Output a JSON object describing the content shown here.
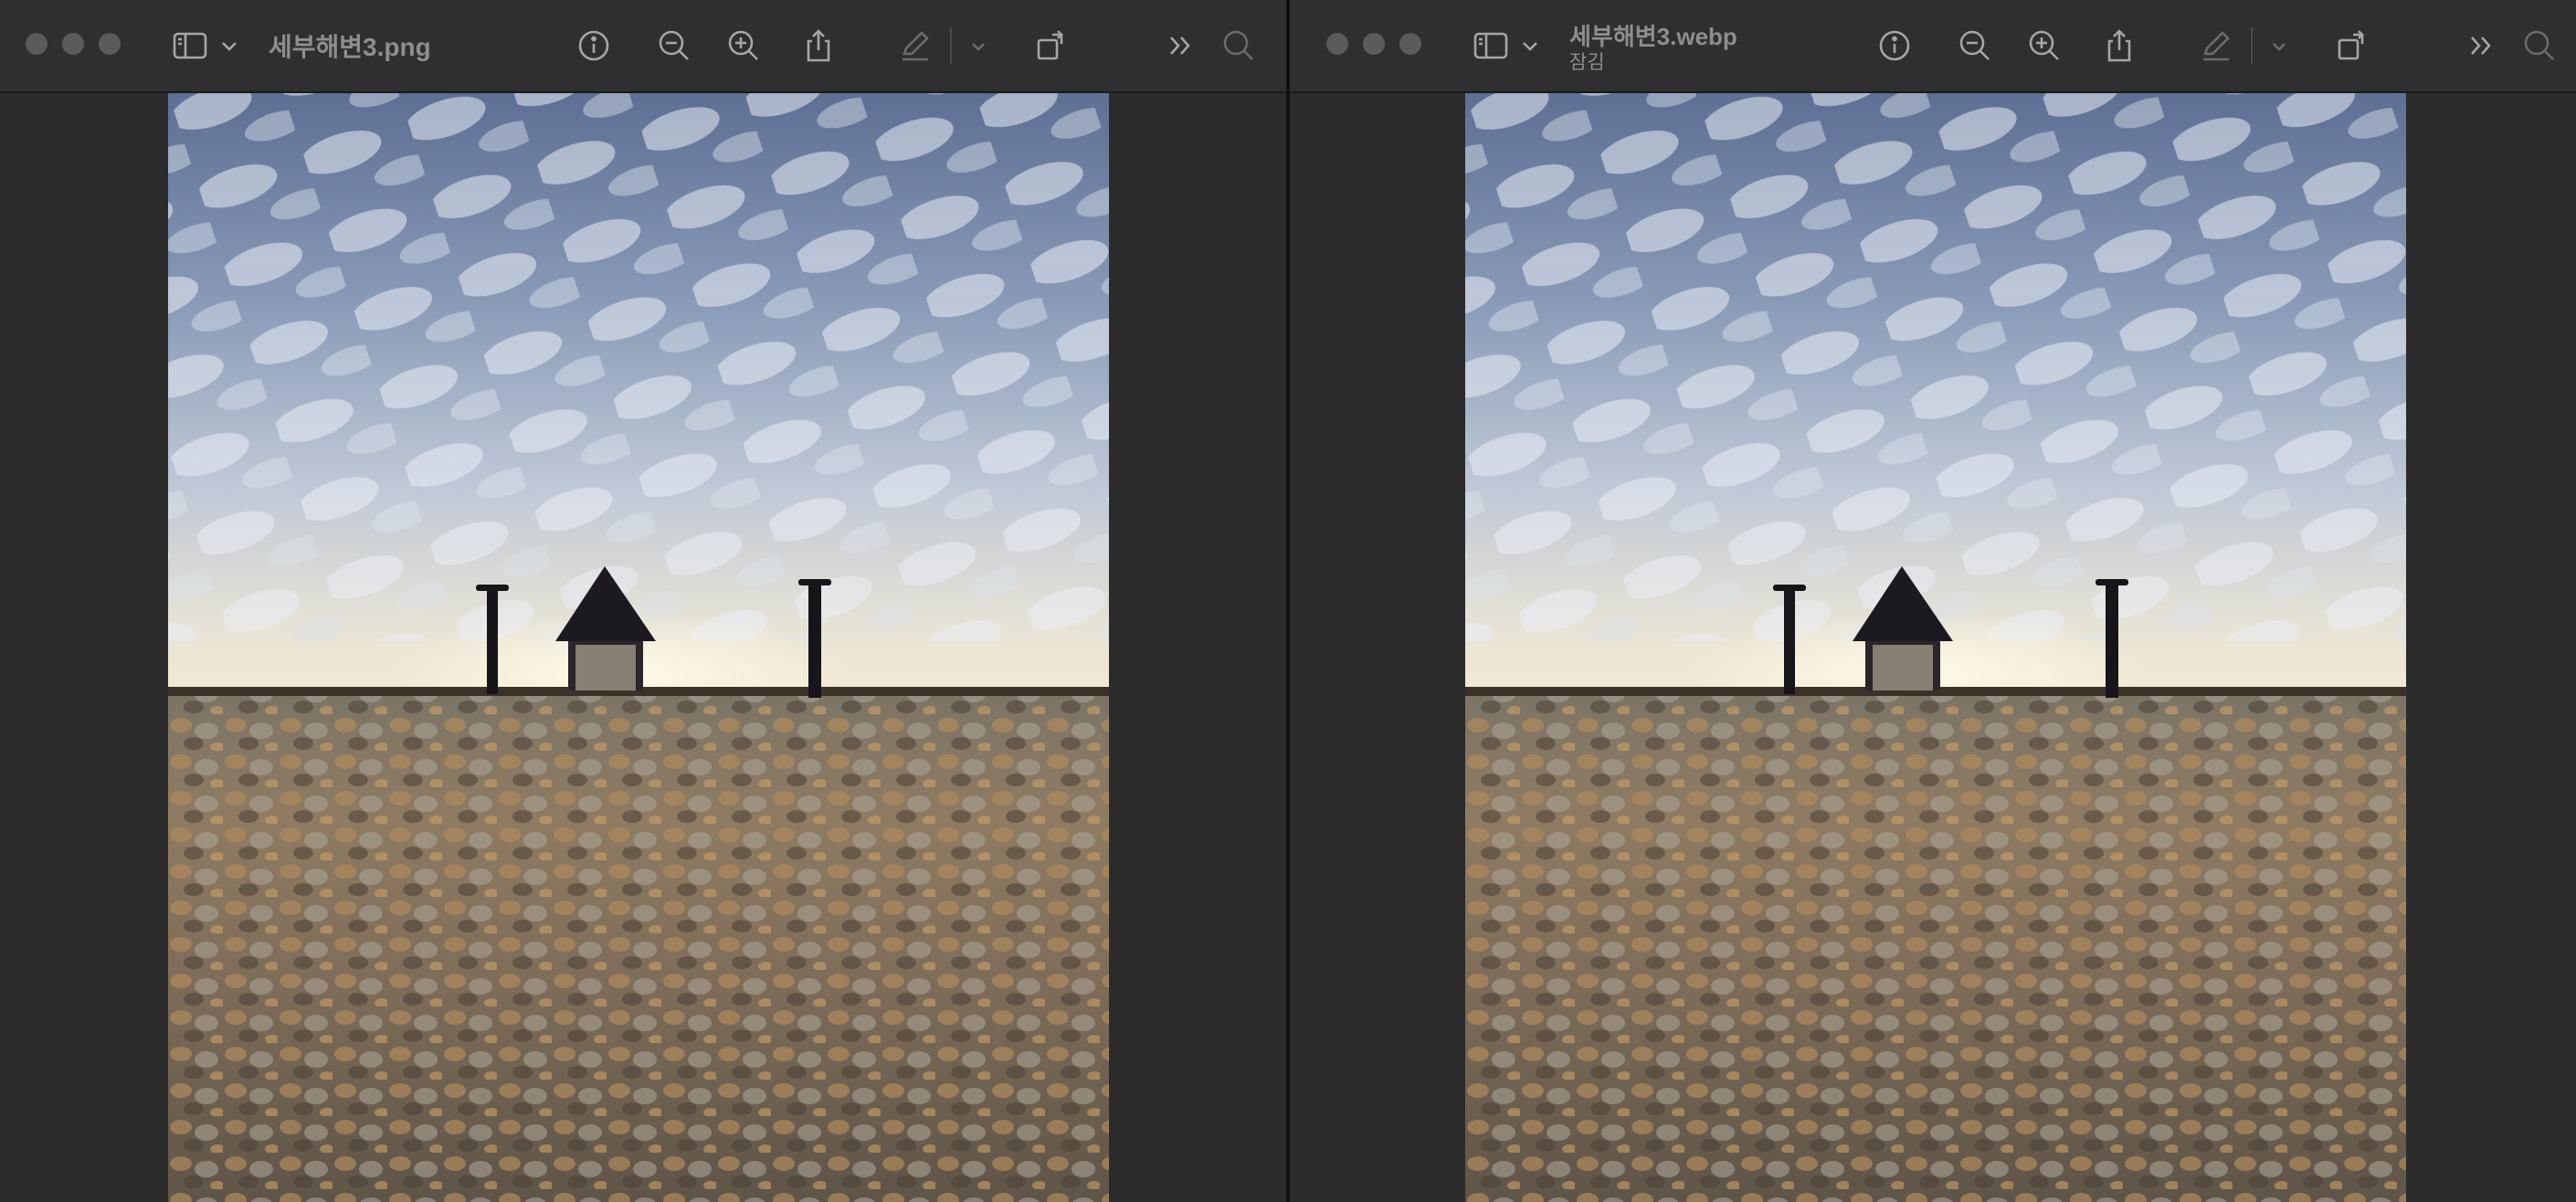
{
  "left_window": {
    "title": "세부해변3.png"
  },
  "right_window": {
    "title": "세부해변3.webp",
    "subtitle": "잠김"
  },
  "icons": {
    "sidebar": "sidebar-toggle-icon",
    "chevron": "chevron-down-icon",
    "info": "info-icon",
    "zoom_out": "zoom-out-icon",
    "zoom_in": "zoom-in-icon",
    "share": "share-icon",
    "markup": "markup-pen-icon",
    "rotate": "rotate-icon",
    "more": "double-chevron-right-icon",
    "search": "search-icon"
  },
  "colors": {
    "toolbar": "#2f2f31",
    "background": "#2b2b2c"
  }
}
